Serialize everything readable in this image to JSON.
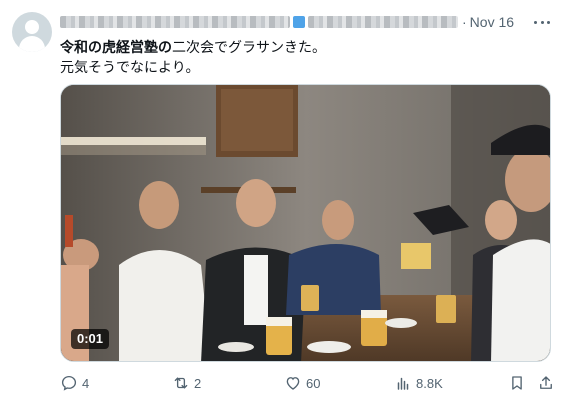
{
  "tweet": {
    "author": {
      "avatar_icon": "default-profile-icon",
      "verified_color": "#1d9bf0"
    },
    "date": "Nov 16",
    "text": {
      "bold": "令和の虎経営塾の",
      "line1_rest": "二次会でグラサンきた。",
      "line2": "元気そうでなにより。"
    },
    "media": {
      "type": "video",
      "timestamp": "0:01"
    },
    "actions": {
      "replies": "4",
      "retweets": "2",
      "likes": "60",
      "views": "8.8K"
    }
  },
  "colors": {
    "text": "#0f1419",
    "secondary": "#536471",
    "border": "#cfd9de"
  }
}
